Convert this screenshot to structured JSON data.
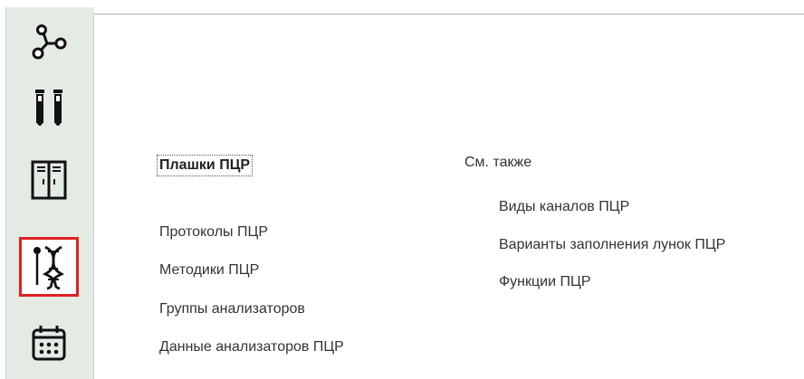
{
  "sidebar": {
    "items": [
      {
        "icon": "molecule-icon"
      },
      {
        "icon": "test-tubes-icon"
      },
      {
        "icon": "lockers-icon"
      },
      {
        "icon": "dna-probe-icon",
        "active": true
      },
      {
        "icon": "calendar-icon"
      }
    ]
  },
  "main": {
    "left_links": {
      "bold_link": "Плашки ПЦР",
      "items": [
        "Протоколы ПЦР",
        "Методики ПЦР",
        "Группы анализаторов",
        "Данные анализаторов ПЦР"
      ]
    },
    "see_also": {
      "title": "См. также",
      "items": [
        "Виды каналов ПЦР",
        "Варианты заполнения лунок ПЦР",
        "Функции ПЦР"
      ]
    }
  },
  "colors": {
    "sidebar_bg": "#e4ebe4",
    "active_border": "#e02020",
    "text": "#333333"
  }
}
